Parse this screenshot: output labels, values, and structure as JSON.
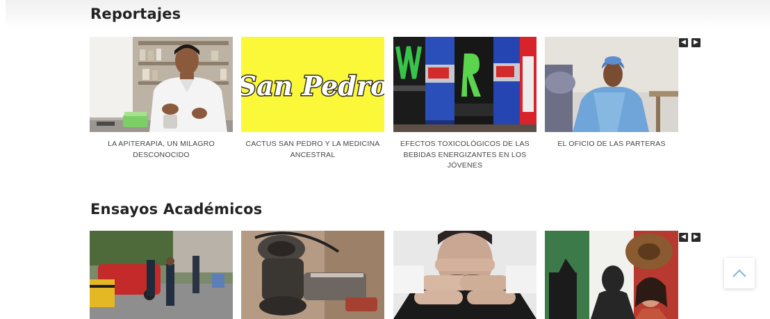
{
  "sections": [
    {
      "title": "Reportajes",
      "articles": [
        {
          "caption": "LA APITERAPIA, UN MILAGRO DESCONOCIDO"
        },
        {
          "caption": "CACTUS SAN PEDRO Y LA MEDICINA ANCESTRAL",
          "image_text": "San Pedro"
        },
        {
          "caption": "EFECTOS TOXICOLÓGICOS DE LAS BEBIDAS ENERGIZANTES EN LOS JÓVENES"
        },
        {
          "caption": "EL OFICIO DE LAS PARTERAS"
        }
      ],
      "carousel": {
        "prev_icon": "chevron-left-icon",
        "next_icon": "chevron-right-icon",
        "prev_glyph": "◀",
        "next_glyph": "▶"
      }
    },
    {
      "title": "Ensayos Académicos",
      "articles": [
        {
          "caption": ""
        },
        {
          "caption": ""
        },
        {
          "caption": ""
        },
        {
          "caption": ""
        }
      ],
      "carousel": {
        "prev_icon": "chevron-left-icon",
        "next_icon": "chevron-right-icon",
        "prev_glyph": "◀",
        "next_glyph": "▶"
      }
    }
  ],
  "back_to_top": {
    "icon": "chevron-up-icon"
  },
  "colors": {
    "nav_button": "#2a2a2a",
    "title": "#222222",
    "caption": "#444444",
    "back_to_top_arrow": "#7fb7d9"
  }
}
